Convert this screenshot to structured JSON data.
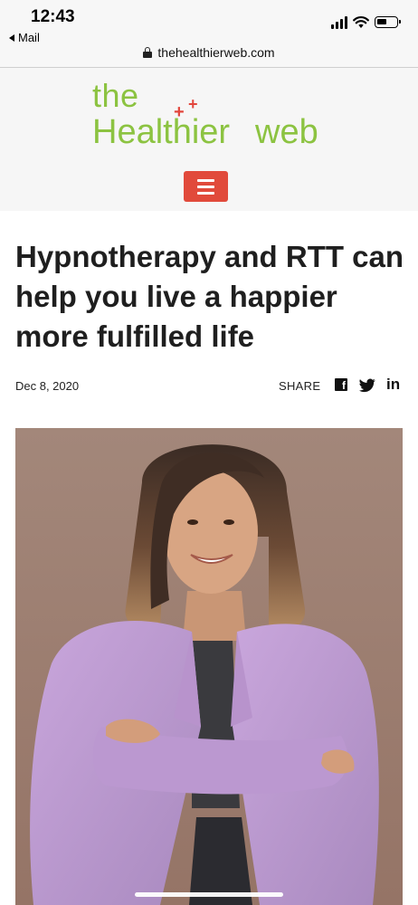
{
  "status_bar": {
    "time": "12:43",
    "back_app": "Mail"
  },
  "browser": {
    "url": "thehealthierweb.com"
  },
  "site": {
    "logo_the": "the",
    "logo_healthier": "Healthier",
    "logo_web": "web",
    "brand_green": "#8cc341",
    "brand_red": "#e14a3b"
  },
  "article": {
    "headline": "Hypnotherapy and RTT can help you live a happier more fulfilled life",
    "date": "Dec 8, 2020",
    "share_label": "SHARE",
    "share_icons": [
      "facebook-icon",
      "twitter-icon",
      "linkedin-icon"
    ],
    "linkedin_text": "in"
  },
  "icons": {
    "menu": "hamburger-icon",
    "lock": "lock-icon"
  }
}
